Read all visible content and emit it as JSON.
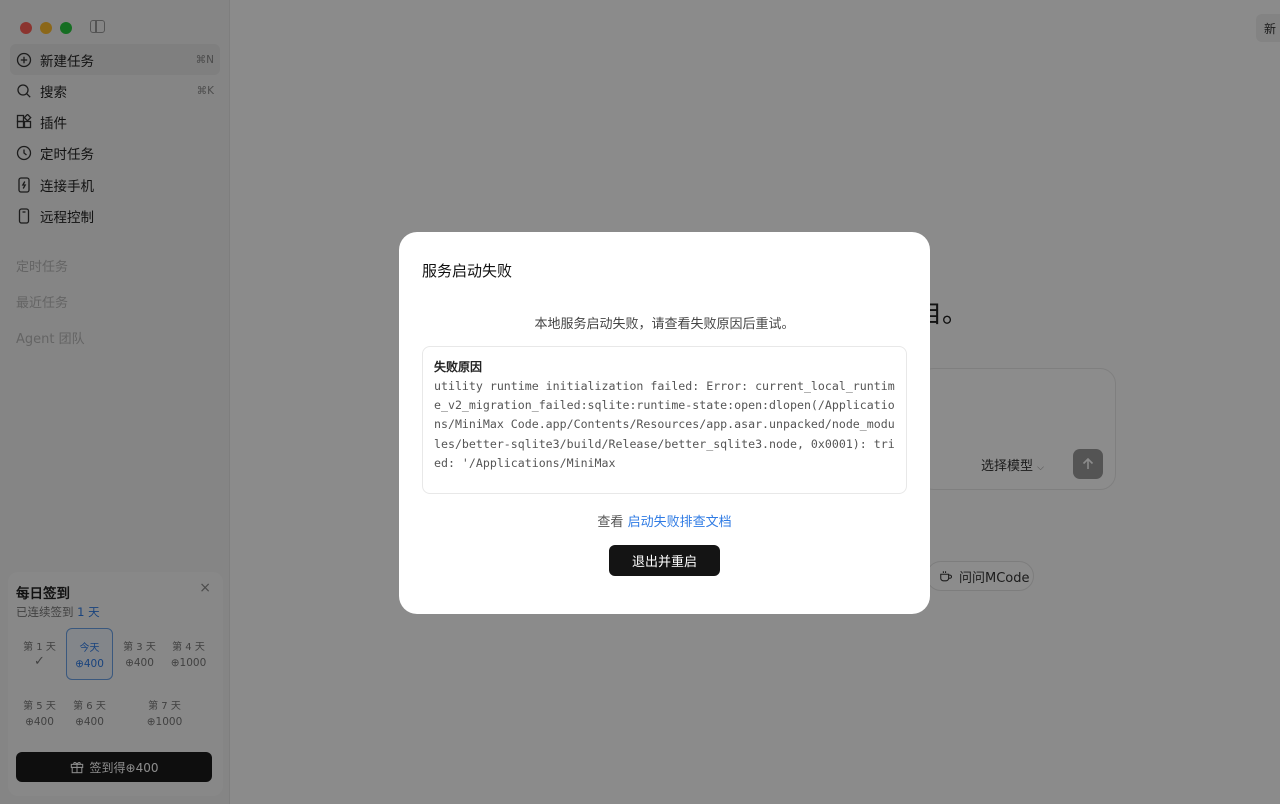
{
  "sidebar": {
    "nav": [
      {
        "label": "新建任务",
        "shortcut": "⌘N",
        "icon": "plus-circle-icon"
      },
      {
        "label": "搜索",
        "shortcut": "⌘K",
        "icon": "search-icon"
      },
      {
        "label": "插件",
        "icon": "plugin-icon"
      },
      {
        "label": "定时任务",
        "icon": "clock-icon"
      },
      {
        "label": "连接手机",
        "icon": "phone-icon"
      },
      {
        "label": "远程控制",
        "icon": "remote-icon"
      }
    ],
    "sections": [
      "定时任务",
      "最近任务",
      "Agent 团队"
    ]
  },
  "checkin": {
    "title": "每日签到",
    "streak_prefix": "已连续签到",
    "streak_value": "1 天",
    "close": "×",
    "days": [
      {
        "label": "第 1 天",
        "amount": "✓"
      },
      {
        "label": "今天",
        "amount": "⊕400"
      },
      {
        "label": "第 3 天",
        "amount": "⊕400"
      },
      {
        "label": "第 4 天",
        "amount": "⊕1000"
      },
      {
        "label": "第 5 天",
        "amount": "⊕400"
      },
      {
        "label": "第 6 天",
        "amount": "⊕400"
      },
      {
        "label": "第 7 天",
        "amount": "⊕1000"
      }
    ],
    "button_label": "签到得⊕400"
  },
  "main": {
    "new_button": "新",
    "heading_fragment": "自。",
    "model_select": "选择模型",
    "ask_chip": "问问MCode"
  },
  "dialog": {
    "title": "服务启动失败",
    "description": "本地服务启动失败，请查看失败原因后重试。",
    "reason_label": "失败原因",
    "reason_text": "utility runtime initialization failed: Error: current_local_runtime_v2_migration_failed:sqlite:runtime-state:open:dlopen(/Applications/MiniMax Code.app/Contents/Resources/app.asar.unpacked/node_modules/better-sqlite3/build/Release/better_sqlite3.node, 0x0001): tried: '/Applications/MiniMax",
    "doc_prefix": "查看",
    "doc_link": "启动失败排查文档",
    "restart_button": "退出并重启"
  },
  "colors": {
    "accent": "#2f7be4",
    "dark_button": "#141414",
    "close_dot": "#fe5f57",
    "min_dot": "#febc2e",
    "max_dot": "#28c840"
  }
}
